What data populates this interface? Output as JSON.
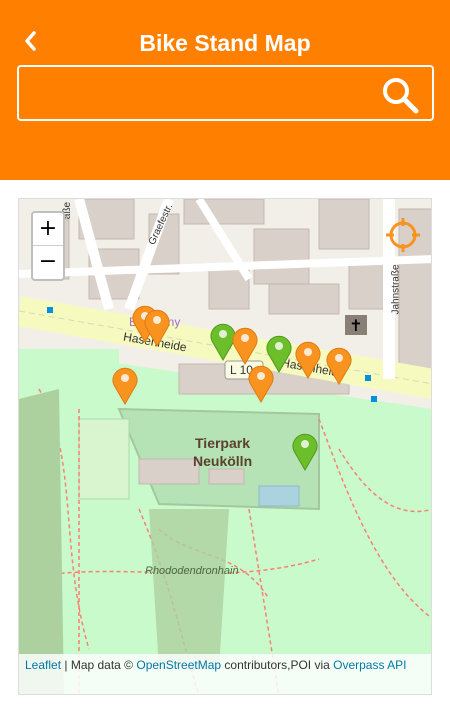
{
  "header": {
    "title": "Bike Stand Map",
    "search_placeholder": ""
  },
  "map": {
    "zoom_in": "+",
    "zoom_out": "−",
    "labels": {
      "street_hasenheide_1": "Hasenheide",
      "street_hasenheide_2": "Hasenheide",
      "road_number": "L 10",
      "park_name_line1": "Tierpark",
      "park_name_line2": "Neukölln",
      "rhododendron": "Rhododendronhain",
      "graefestr": "Graefestr.",
      "jahnstr": "Jahnstraße",
      "strasse_left": "aße",
      "company": "Br    mpany"
    },
    "markers": [
      {
        "color": "orange"
      },
      {
        "color": "orange"
      },
      {
        "color": "green"
      },
      {
        "color": "orange"
      },
      {
        "color": "green"
      },
      {
        "color": "orange"
      },
      {
        "color": "orange"
      },
      {
        "color": "orange"
      },
      {
        "color": "orange"
      },
      {
        "color": "green"
      }
    ],
    "attribution": {
      "leaflet": "Leaflet",
      "sep": " | Map data © ",
      "osm": "OpenStreetMap",
      "middle": " contributors,POI via ",
      "overpass": "Overpass API"
    }
  },
  "colors": {
    "brand": "#ff8000",
    "marker_orange": "#f7931e",
    "marker_green": "#6cbf2a",
    "park": "#c8facc"
  }
}
